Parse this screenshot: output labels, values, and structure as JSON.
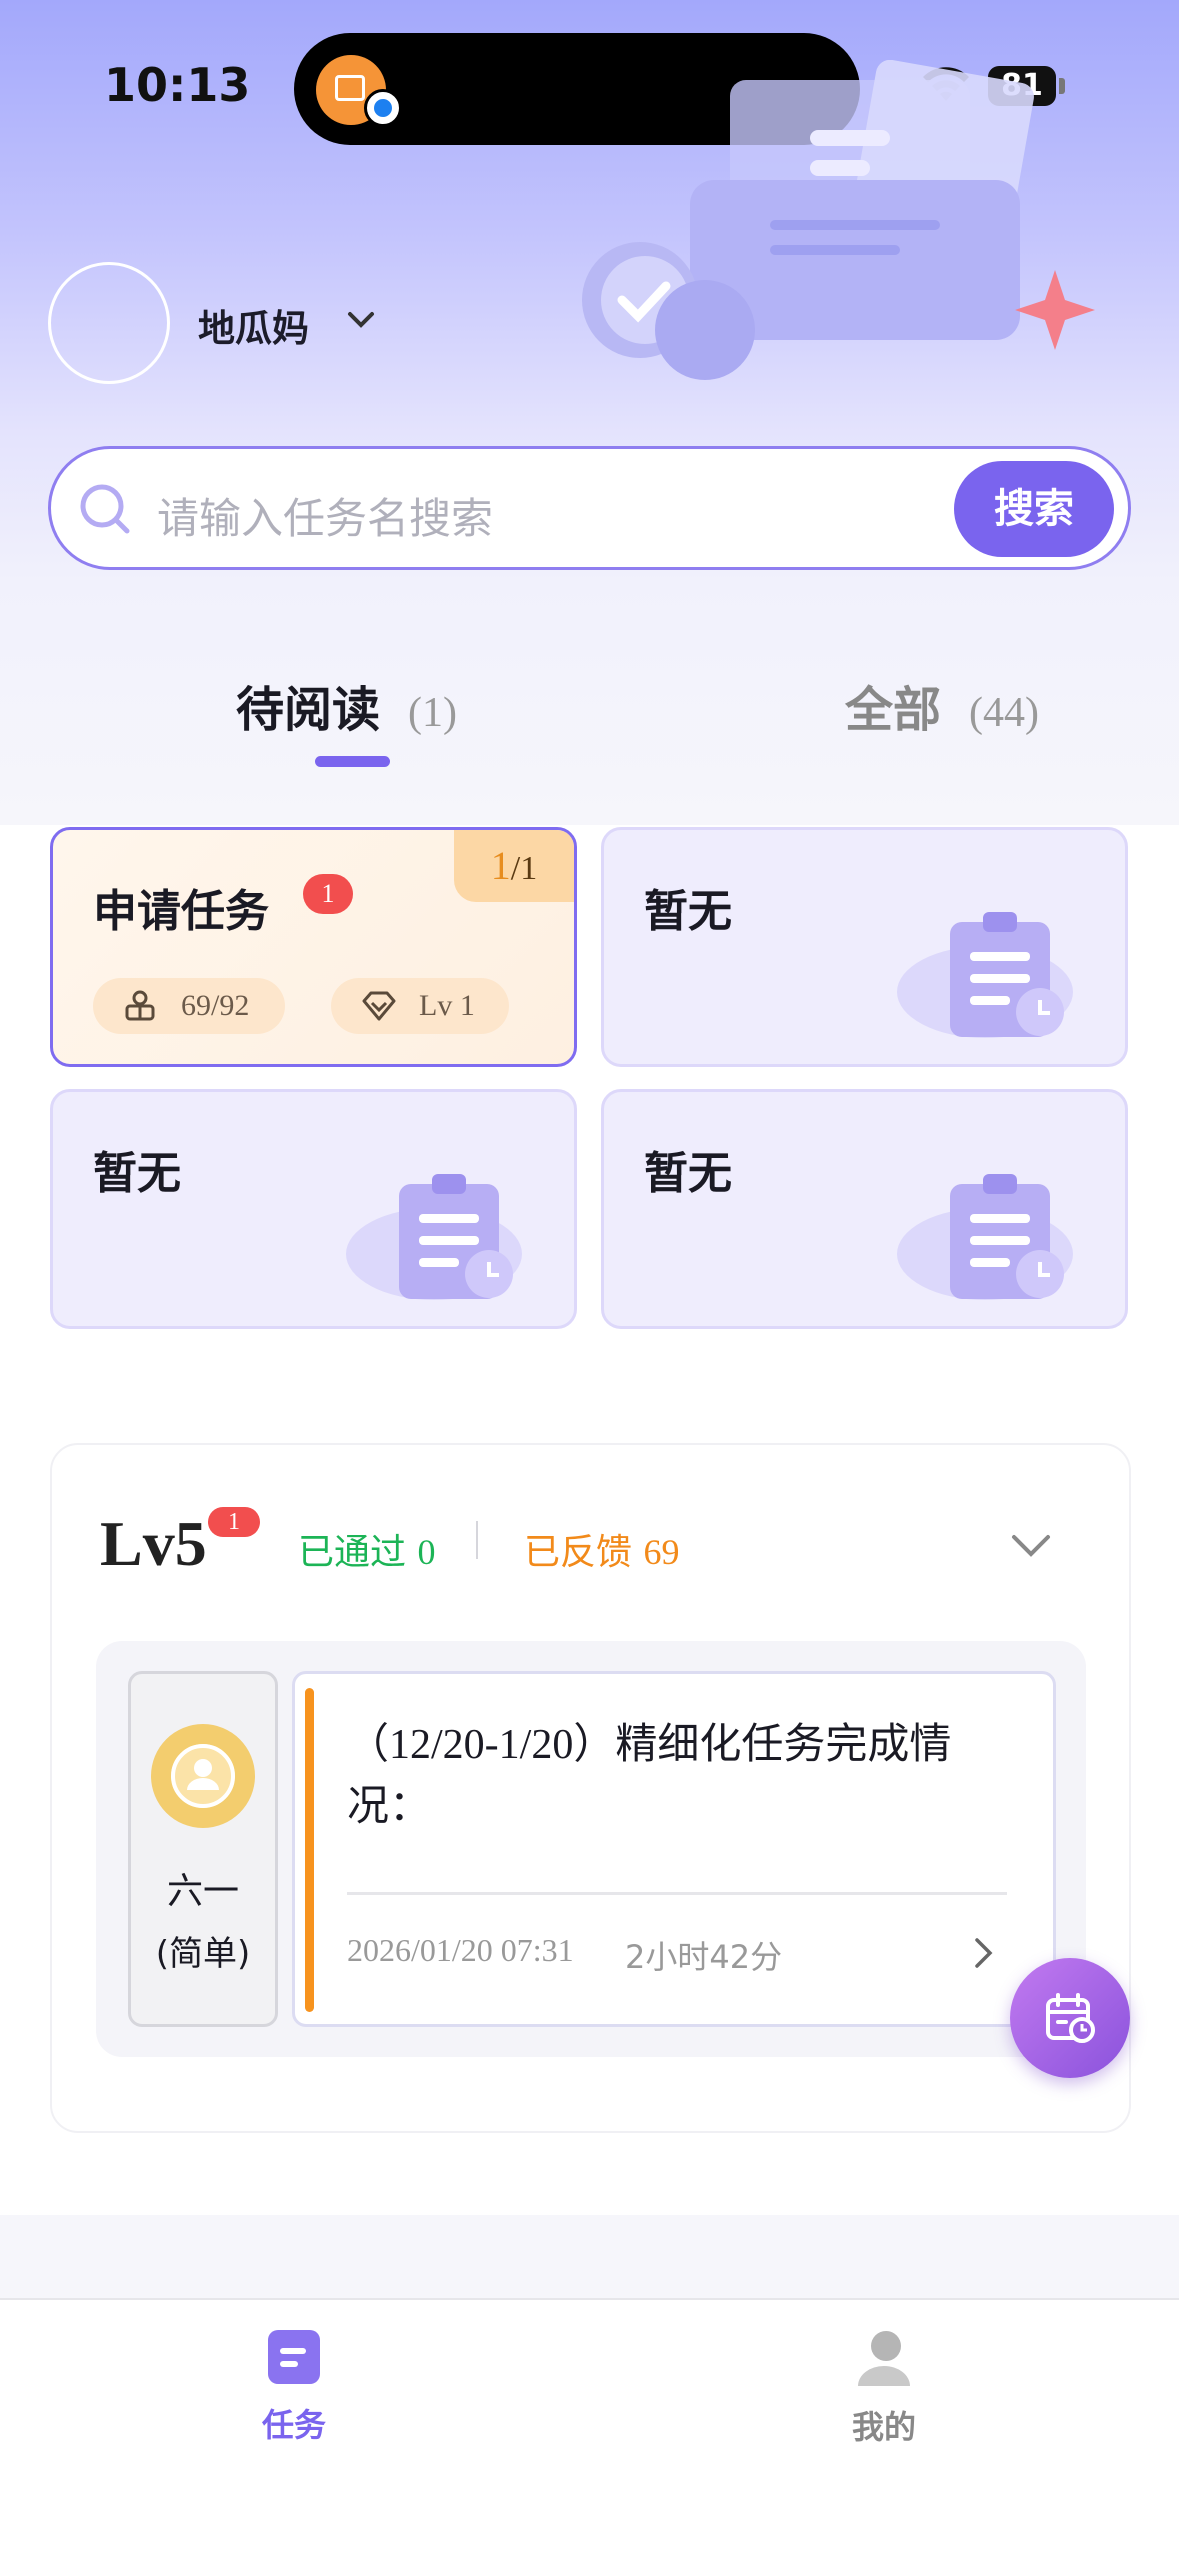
{
  "status_bar": {
    "time": "10:13",
    "battery": "81"
  },
  "user": {
    "name": "地瓜妈"
  },
  "search": {
    "placeholder": "请输入任务名搜索",
    "button": "搜索"
  },
  "tabs": [
    {
      "label": "待阅读",
      "count": "(1)"
    },
    {
      "label": "全部",
      "count": "(44)"
    }
  ],
  "cards": [
    {
      "title": "申请任务",
      "badge": "1",
      "corner_num": "1",
      "corner_total": "/1",
      "progress": "69/92",
      "level": "Lv 1"
    },
    {
      "title": "暂无"
    },
    {
      "title": "暂无"
    },
    {
      "title": "暂无"
    }
  ],
  "level_section": {
    "level": "Lv5",
    "badge": "1",
    "passed_label": "已通过",
    "passed_count": "0",
    "feedback_label": "已反馈",
    "feedback_count": "69"
  },
  "task": {
    "assignee_name": "六一",
    "difficulty": "(简单)",
    "title": "（12/20-1/20）精细化任务完成情况：",
    "date": "2026/01/20 07:31",
    "duration": "2小时42分"
  },
  "bottom_nav": [
    {
      "label": "任务"
    },
    {
      "label": "我的"
    }
  ],
  "colors": {
    "accent": "#7a64ee",
    "passed": "#1cb456",
    "feedback": "#f28a1a",
    "badge": "#f24e4e",
    "task_bar": "#f7931e"
  }
}
